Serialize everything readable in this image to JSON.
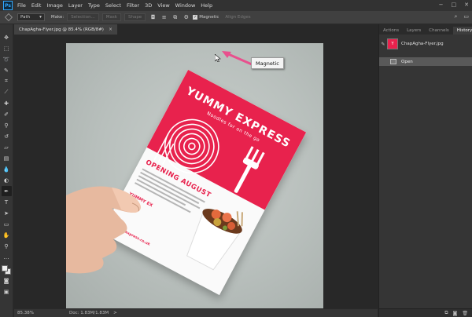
{
  "menu": {
    "logo": "Ps",
    "items": [
      "File",
      "Edit",
      "Image",
      "Layer",
      "Type",
      "Select",
      "Filter",
      "3D",
      "View",
      "Window",
      "Help"
    ],
    "window_controls": [
      "−",
      "□",
      "✕"
    ]
  },
  "options": {
    "mode_value": "Path",
    "make_label": "Make:",
    "selection_button": "Selection...",
    "mask_button": "Mask",
    "shape_button": "Shape",
    "magnetic_label": "Magnetic",
    "align_edges_label": "Align Edges"
  },
  "doc_tab": {
    "title": "ChapAgha-Flyer.jpg @ 85.4% (RGB/8#)",
    "close": "×"
  },
  "flyer": {
    "brand": "YUMMY EXPRESS",
    "tagline": "Noodles for on the go",
    "opening": "OPENING AUGUST",
    "small_brand": "YUMMY EX",
    "site": "yummyexpress.co.uk",
    "brand_color": "#e8224d"
  },
  "tooltip": "Magnetic",
  "status": {
    "zoom": "85.38%",
    "doc": "Doc: 1.83M/1.83M",
    "arrow": ">"
  },
  "panels": {
    "tabs": [
      "Actions",
      "Layers",
      "Channels",
      "History"
    ],
    "active_tab": "History",
    "snapshot_name": "ChapAgha-Flyer.jpg",
    "states": [
      "Open"
    ]
  },
  "tools": [
    "move-tool-icon",
    "marquee-tool-icon",
    "lasso-tool-icon",
    "quick-select-tool-icon",
    "crop-tool-icon",
    "eyedropper-tool-icon",
    "healing-brush-tool-icon",
    "brush-tool-icon",
    "clone-stamp-tool-icon",
    "history-brush-tool-icon",
    "eraser-tool-icon",
    "gradient-tool-icon",
    "blur-tool-icon",
    "dodge-tool-icon",
    "pen-tool-icon",
    "type-tool-icon",
    "path-select-tool-icon",
    "rectangle-tool-icon",
    "hand-tool-icon",
    "zoom-tool-icon"
  ]
}
